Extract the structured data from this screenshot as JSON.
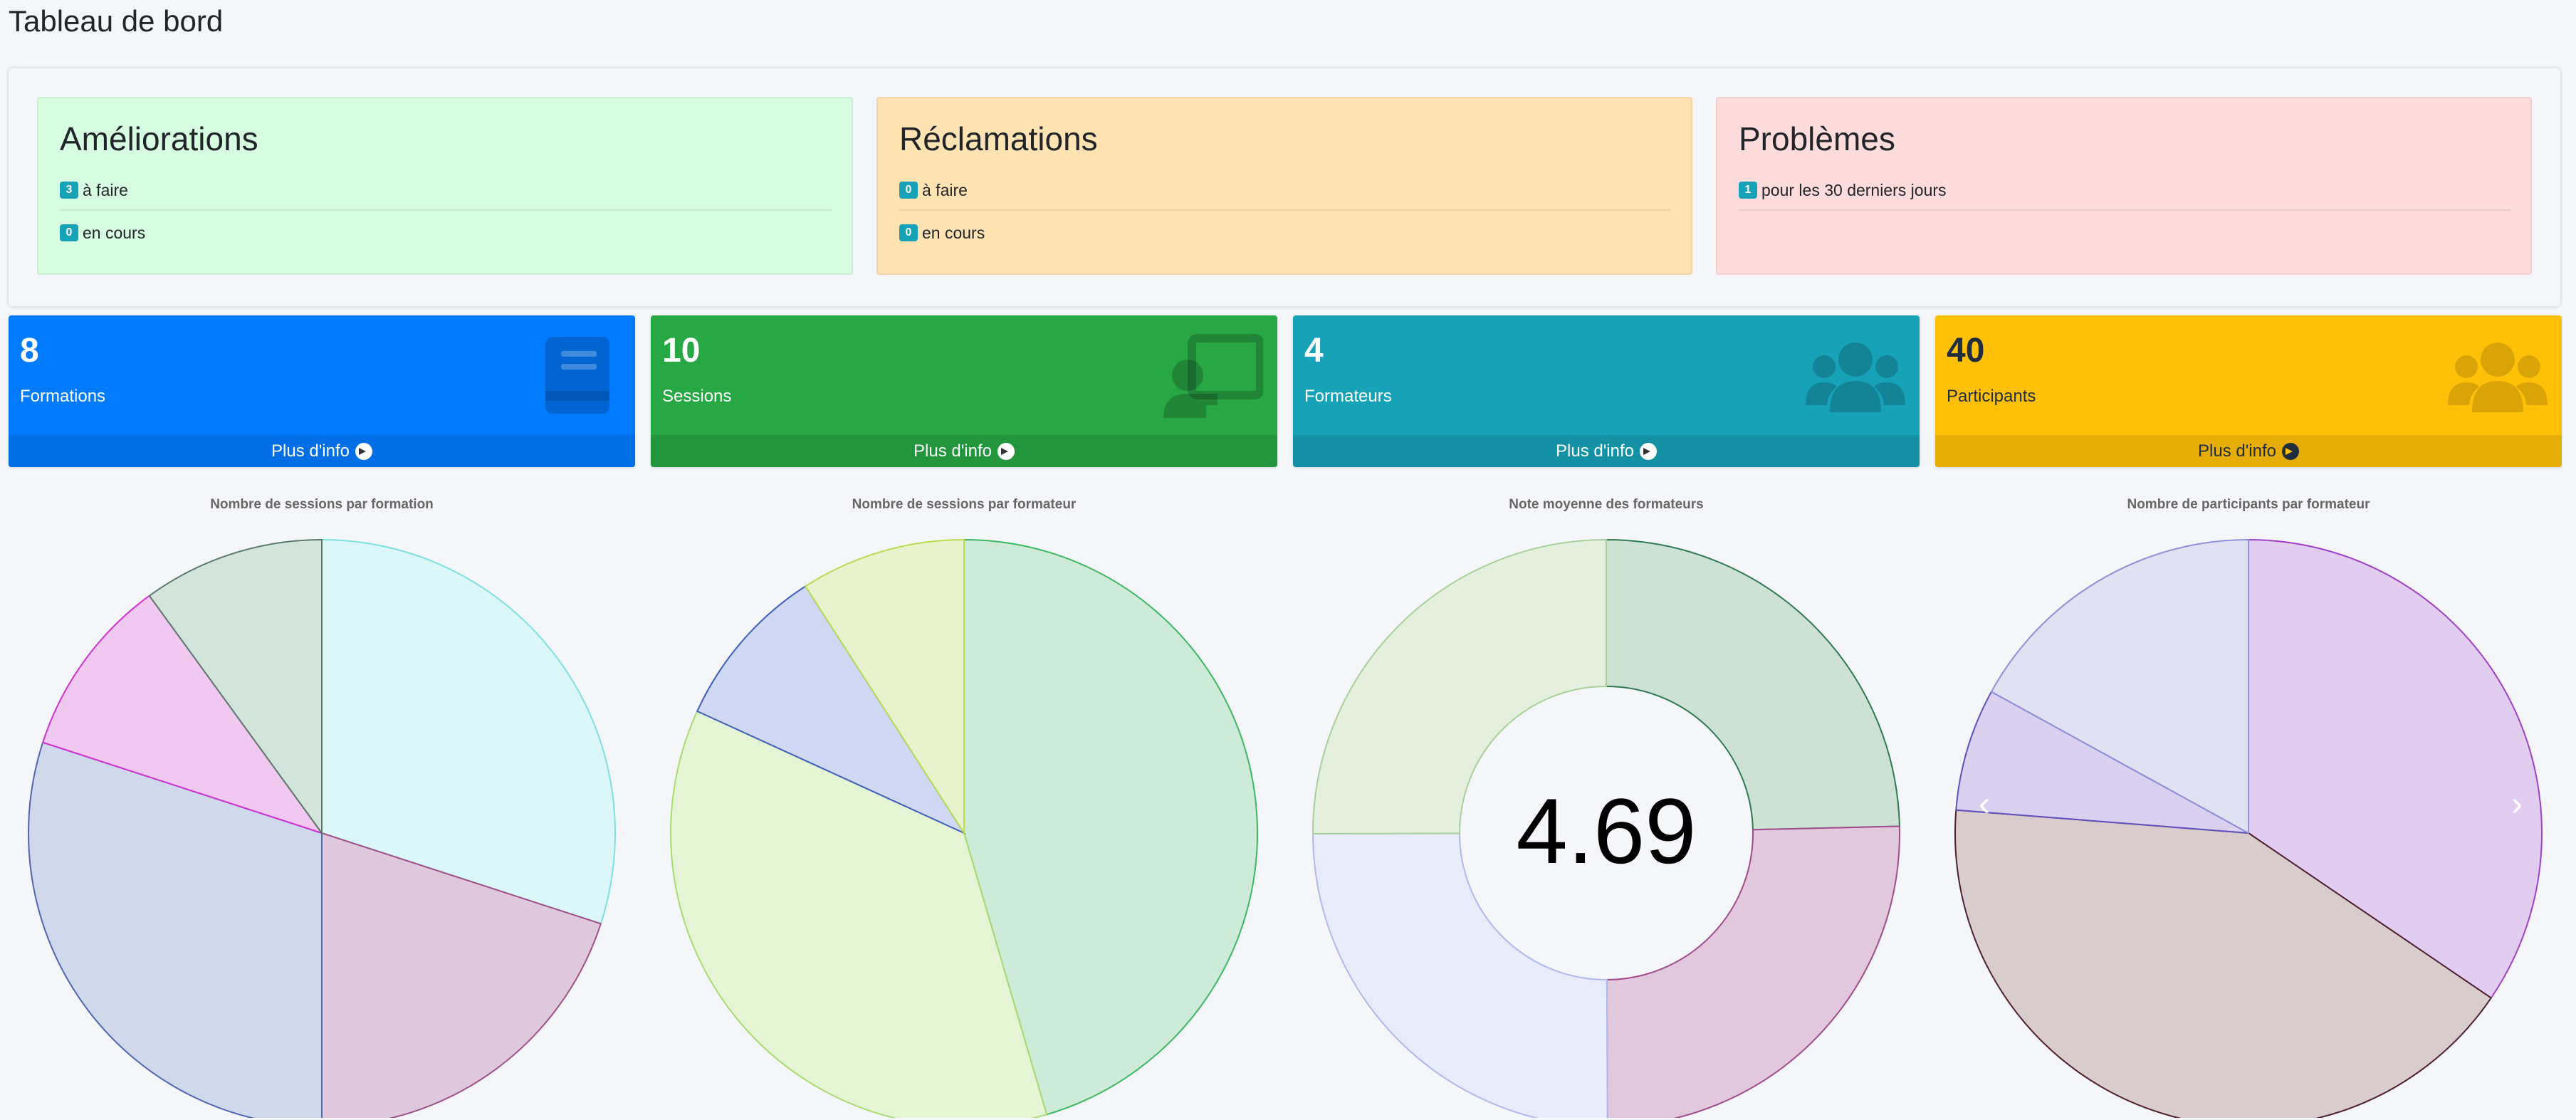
{
  "page": {
    "title": "Tableau de bord"
  },
  "status_boxes": [
    {
      "title": "Améliorations",
      "color": "#d7fde0",
      "rows": [
        {
          "count": "3",
          "text": "à faire"
        },
        {
          "count": "0",
          "text": "en cours"
        }
      ]
    },
    {
      "title": "Réclamations",
      "color": "#ffe3b3",
      "rows": [
        {
          "count": "0",
          "text": "à faire"
        },
        {
          "count": "0",
          "text": "en cours"
        }
      ]
    },
    {
      "title": "Problèmes",
      "color": "#ffdcdc",
      "rows": [
        {
          "count": "1",
          "text": "pour les 30 derniers jours"
        }
      ]
    }
  ],
  "small_boxes": [
    {
      "count": "8",
      "label": "Formations",
      "link": "Plus d'info",
      "color": "#007bff",
      "icon": "book-icon"
    },
    {
      "count": "10",
      "label": "Sessions",
      "link": "Plus d'info",
      "color": "#28a745",
      "icon": "chalkboard-teacher-icon"
    },
    {
      "count": "4",
      "label": "Formateurs",
      "link": "Plus d'info",
      "color": "#17a2b8",
      "icon": "users-icon"
    },
    {
      "count": "40",
      "label": "Participants",
      "link": "Plus d'info",
      "color": "#ffc107",
      "icon": "users-icon"
    }
  ],
  "chart_data": [
    {
      "type": "pie",
      "title": "Nombre de sessions par formation",
      "values": [
        3,
        2,
        3,
        1,
        1
      ],
      "colors": [
        "#dcf7f7",
        "#e0c8dc",
        "#d0d8ec",
        "#f0c8f0",
        "#d2e4dc"
      ],
      "borders": [
        "#7ee0e0",
        "#a0508a",
        "#5066b0",
        "#d030d0",
        "#5a7a6a"
      ]
    },
    {
      "type": "pie",
      "title": "Nombre de sessions par formateur",
      "values": [
        5,
        4,
        1,
        1
      ],
      "colors": [
        "#ceebda",
        "#e4f4d4",
        "#d0d8f4",
        "#e8f2cc"
      ],
      "borders": [
        "#3cb860",
        "#a8dc70",
        "#4060c0",
        "#b8dc50"
      ]
    },
    {
      "type": "doughnut",
      "title": "Note moyenne des formateurs",
      "center_text": "4.69",
      "values": [
        4.625,
        4.75,
        4.7,
        4.7
      ],
      "colors": [
        "#cde2d5",
        "#e2c8dc",
        "#e8ebf9",
        "#e4f0dd"
      ],
      "borders": [
        "#2f7a52",
        "#a04c8c",
        "#b0b8f0",
        "#a8d098"
      ]
    },
    {
      "type": "pie",
      "title": "Nombre de participants par formateur",
      "values": [
        13.8,
        16.7,
        2.7,
        6.8
      ],
      "colors": [
        "#e2cdf1",
        "#d8cccc",
        "#dad1f0",
        "#e2e0f3"
      ],
      "borders": [
        "#a040c8",
        "#502030",
        "#6050c0",
        "#9090d8"
      ]
    }
  ]
}
